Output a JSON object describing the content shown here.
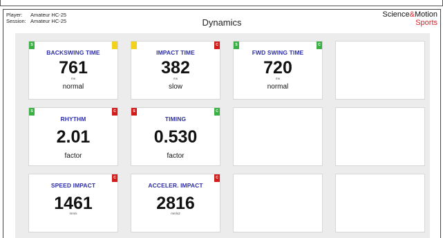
{
  "header": {
    "player_label": "Player:",
    "player_value": "Amateur HC-25",
    "session_label": "Session:",
    "session_value": "Amateur HC-25",
    "title": "Dynamics",
    "brand_science": "Science",
    "brand_amp": "&",
    "brand_motion": "Motion",
    "brand_sports": "Sports"
  },
  "cards": {
    "backswing": {
      "title": "BACKSWING TIME",
      "value": "761",
      "unit": "ms",
      "state": "normal",
      "left_badge": "S",
      "right_badge": ""
    },
    "impact": {
      "title": "IMPACT TIME",
      "value": "382",
      "unit": "ms",
      "state": "slow",
      "left_badge": "",
      "right_badge": "C"
    },
    "fwdswing": {
      "title": "FWD SWING TIME",
      "value": "720",
      "unit": "ms",
      "state": "normal",
      "left_badge": "S",
      "right_badge": "C"
    },
    "rhythm": {
      "title": "RHYTHM",
      "value": "2.01",
      "state": "factor",
      "left_badge": "S",
      "right_badge": "C"
    },
    "timing": {
      "title": "TIMING",
      "value": "0.530",
      "state": "factor",
      "left_badge": "S",
      "right_badge": "C"
    },
    "speed": {
      "title": "SPEED IMPACT",
      "value": "1461",
      "unit": "mm/s",
      "right_badge": "C"
    },
    "accel": {
      "title": "ACCELER. IMPACT",
      "value": "2816",
      "unit": "mm/s2",
      "right_badge": "C"
    }
  },
  "colors": {
    "title_blue": "#2d2ea8",
    "badge_green": "#3bb143",
    "badge_red": "#d21c1c",
    "badge_yellow": "#f2d21b",
    "brand_red": "#e0202a"
  }
}
